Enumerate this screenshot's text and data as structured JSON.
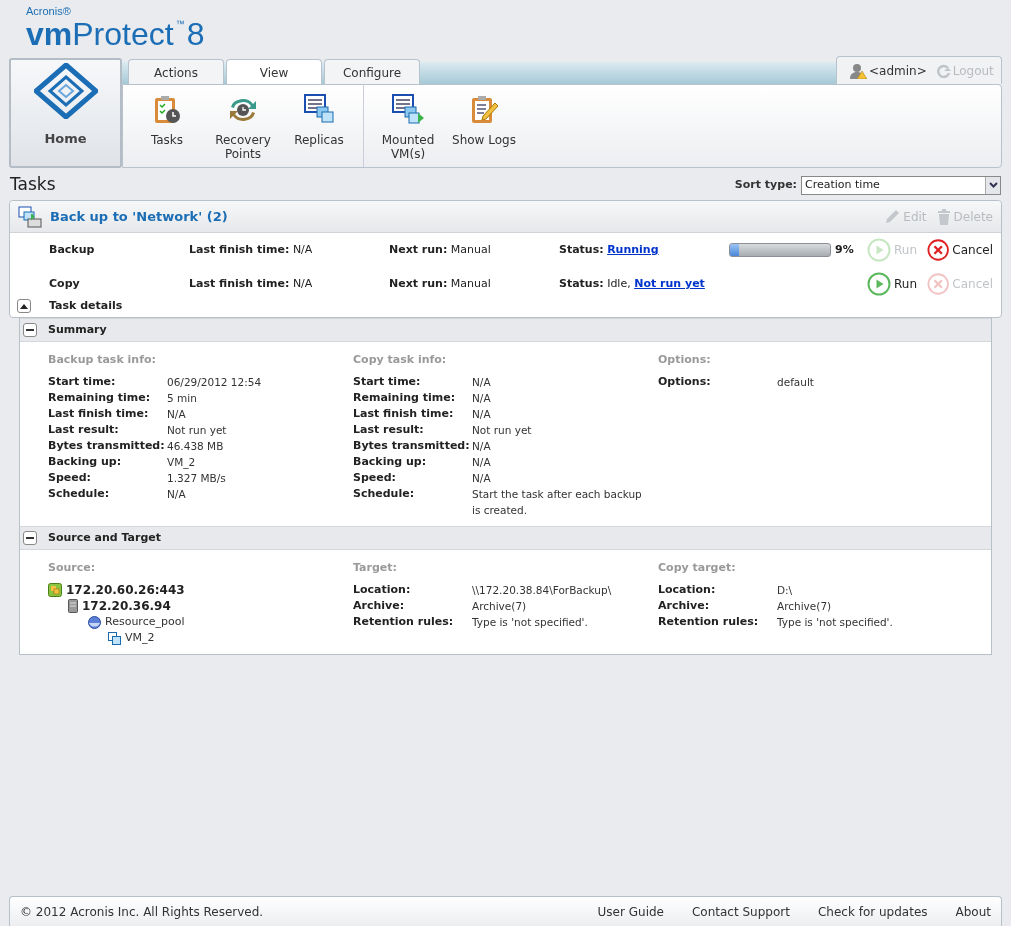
{
  "brand": {
    "vendor": "Acronis®",
    "product_bold": "vm",
    "product": "Protect",
    "tm": "™",
    "version": "8"
  },
  "home": {
    "label": "Home"
  },
  "tabs": [
    {
      "label": "Actions",
      "selected": false
    },
    {
      "label": "View",
      "selected": true
    },
    {
      "label": "Configure",
      "selected": false
    }
  ],
  "toolbar": [
    [
      {
        "label": "Tasks",
        "kind": "tasks"
      },
      {
        "label": "Recovery Points",
        "kind": "recovery"
      },
      {
        "label": "Replicas",
        "kind": "replicas"
      }
    ],
    [
      {
        "label": "Mounted VM(s)",
        "kind": "mounted"
      },
      {
        "label": "Show Logs",
        "kind": "logs"
      }
    ]
  ],
  "user": {
    "name": "<admin>",
    "logout": "Logout",
    "logout_disabled": true
  },
  "page_title": "Tasks",
  "sort": {
    "label": "Sort type:",
    "value": "Creation time"
  },
  "task_group": {
    "title": "Back up to 'Network' (2)",
    "actions": [
      {
        "label": "Edit",
        "kind": "edit",
        "disabled": true
      },
      {
        "label": "Delete",
        "kind": "delete",
        "disabled": true
      }
    ],
    "tasks": [
      {
        "name": "Backup",
        "last_finish_label": "Last finish time:",
        "last_finish": "N/A",
        "next_run_label": "Next run:",
        "next_run": "Manual",
        "status_label": "Status:",
        "status_link": "Running",
        "progress": {
          "level": 0.09,
          "reading": "9%"
        },
        "buttons": [
          {
            "label": "Run",
            "kind": "run",
            "disabled": true
          },
          {
            "label": "Cancel",
            "kind": "cancel",
            "disabled": false
          }
        ]
      },
      {
        "name": "Copy",
        "last_finish_label": "Last finish time:",
        "last_finish": "N/A",
        "next_run_label": "Next run:",
        "next_run": "Manual",
        "status_label": "Status:",
        "status_text": "Idle,",
        "status_link": "Not run yet",
        "buttons": [
          {
            "label": "Run",
            "kind": "run",
            "disabled": false
          },
          {
            "label": "Cancel",
            "kind": "cancel",
            "disabled": true
          }
        ]
      }
    ],
    "details_label": "Task details",
    "details_expanded": true
  },
  "sections": [
    {
      "title": "Summary",
      "expanded": true,
      "columns": [
        {
          "heading": "Backup task info:",
          "rows": [
            {
              "label": "Start time:",
              "value": "06/29/2012 12:54"
            },
            {
              "label": "Remaining time:",
              "value": "5 min"
            },
            {
              "label": "Last finish time:",
              "value": "N/A"
            },
            {
              "label": "Last result:",
              "value": "Not run yet"
            },
            {
              "label": "Bytes transmitted:",
              "value": "46.438 MB"
            },
            {
              "label": "Backing up:",
              "value": "VM_2"
            },
            {
              "label": "Speed:",
              "value": "1.327 MB/s"
            },
            {
              "label": "Schedule:",
              "value": "N/A"
            }
          ]
        },
        {
          "heading": "Copy task info:",
          "rows": [
            {
              "label": "Start time:",
              "value": "N/A"
            },
            {
              "label": "Remaining time:",
              "value": "N/A"
            },
            {
              "label": "Last finish time:",
              "value": "N/A"
            },
            {
              "label": "Last result:",
              "value": "Not run yet"
            },
            {
              "label": "Bytes transmitted:",
              "value": "N/A"
            },
            {
              "label": "Backing up:",
              "value": "N/A"
            },
            {
              "label": "Speed:",
              "value": "N/A"
            },
            {
              "label": "Schedule:",
              "value": "Start the task after each backup is created."
            }
          ]
        },
        {
          "heading": "Options:",
          "rows": [
            {
              "label": "Options:",
              "value": "default"
            }
          ]
        }
      ]
    },
    {
      "title": "Source and Target",
      "expanded": true,
      "columns": [
        {
          "heading": "Source:",
          "tree": [
            {
              "label": "172.20.60.26:443",
              "kind": "host",
              "children": [
                {
                  "label": "172.20.36.94",
                  "kind": "server",
                  "children": [
                    {
                      "label": "Resource_pool",
                      "kind": "pool",
                      "children": [
                        {
                          "label": "VM_2",
                          "kind": "vm"
                        }
                      ]
                    }
                  ]
                }
              ]
            }
          ]
        },
        {
          "heading": "Target:",
          "rows": [
            {
              "label": "Location:",
              "value": "\\\\172.20.38.84\\ForBackup\\"
            },
            {
              "label": "Archive:",
              "value": "Archive(7)"
            },
            {
              "label": "Retention rules:",
              "value": "Type is 'not specified'."
            }
          ]
        },
        {
          "heading": "Copy target:",
          "rows": [
            {
              "label": "Location:",
              "value": "D:\\"
            },
            {
              "label": "Archive:",
              "value": "Archive(7)"
            },
            {
              "label": "Retention rules:",
              "value": "Type is 'not specified'."
            }
          ]
        }
      ]
    }
  ],
  "footer": {
    "copyright": "© 2012 Acronis Inc. All Rights Reserved.",
    "links": [
      "User Guide",
      "Contact Support",
      "Check for updates",
      "About"
    ]
  }
}
